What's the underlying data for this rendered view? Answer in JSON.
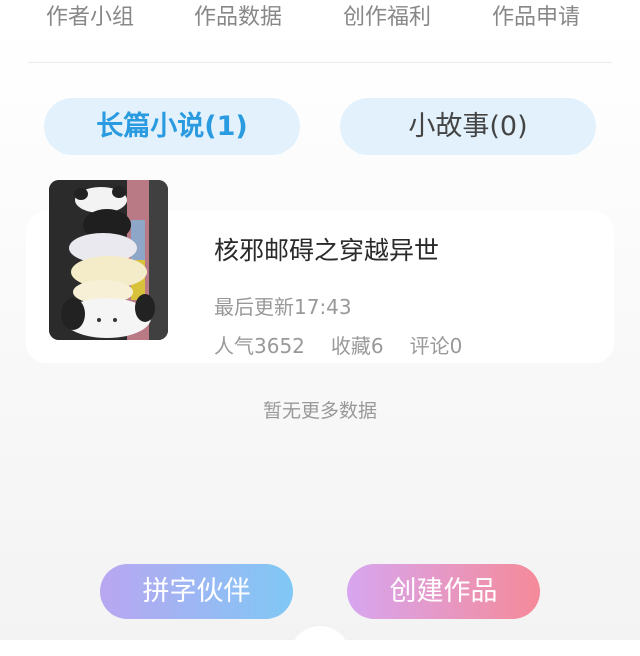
{
  "top_tabs": [
    "作者小组",
    "作品数据",
    "创作福利",
    "作品申请"
  ],
  "category_tabs": {
    "novel": "长篇小说(1)",
    "story": "小故事(0)"
  },
  "book": {
    "title": "核邪邮碍之穿越异世",
    "update": "最后更新17:43",
    "popularity": "人气3652",
    "favorites": "收藏6",
    "comments": "评论0",
    "cover_icon": "panda-stack-illustration"
  },
  "list_end": "暂无更多数据",
  "buttons": {
    "partner": "拼字伙伴",
    "create": "创建作品"
  },
  "colors": {
    "accent_blue": "#2a9be0",
    "pill_bg": "#e2f1fb"
  }
}
